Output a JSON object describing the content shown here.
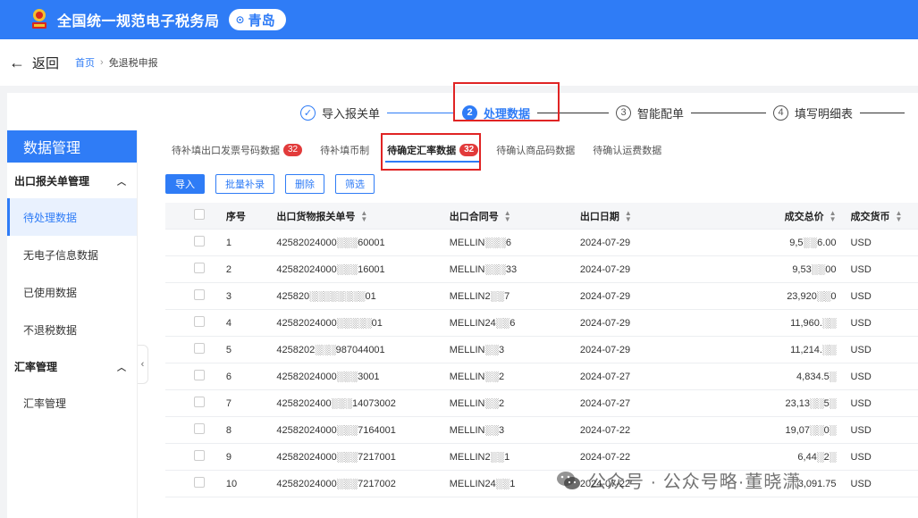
{
  "header": {
    "title": "全国统一规范电子税务局",
    "region": "青岛"
  },
  "nav": {
    "back_label": "返回",
    "breadcrumb": [
      "首页",
      "免退税申报"
    ]
  },
  "steps": [
    {
      "num": "✓",
      "label": "导入报关单",
      "state": "done"
    },
    {
      "num": "2",
      "label": "处理数据",
      "state": "active"
    },
    {
      "num": "3",
      "label": "智能配单",
      "state": "todo"
    },
    {
      "num": "4",
      "label": "填写明细表",
      "state": "todo"
    }
  ],
  "sidebar": {
    "title": "数据管理",
    "groups": [
      {
        "label": "出口报关单管理",
        "items": [
          "待处理数据",
          "无电子信息数据",
          "已使用数据",
          "不退税数据"
        ]
      },
      {
        "label": "汇率管理",
        "items": [
          "汇率管理"
        ]
      }
    ]
  },
  "tabs": [
    {
      "label": "待补填出口发票号码数据",
      "badge": "32"
    },
    {
      "label": "待补填币制",
      "badge": ""
    },
    {
      "label": "待确定汇率数据",
      "badge": "32"
    },
    {
      "label": "待确认商品码数据",
      "badge": ""
    },
    {
      "label": "待确认运费数据",
      "badge": ""
    }
  ],
  "toolbar": {
    "import": "导入",
    "batch": "批量补录",
    "delete": "删除",
    "filter": "筛选"
  },
  "table": {
    "columns": [
      "序号",
      "出口货物报关单号",
      "出口合同号",
      "出口日期",
      "成交总价",
      "成交货币"
    ],
    "rows": [
      [
        "1",
        "42582024000░░░60001",
        "MELLIN░░░6",
        "2024-07-29",
        "9,5░░6.00",
        "USD"
      ],
      [
        "2",
        "42582024000░░░16001",
        "MELLIN░░░33",
        "2024-07-29",
        "9,53░░00",
        "USD"
      ],
      [
        "3",
        "425820░░░░░░░░01",
        "MELLIN2░░7",
        "2024-07-29",
        "23,920░░0",
        "USD"
      ],
      [
        "4",
        "42582024000░░░░░01",
        "MELLIN24░░6",
        "2024-07-29",
        "11,960.░░",
        "USD"
      ],
      [
        "5",
        "4258202░░░987044001",
        "MELLIN░░3",
        "2024-07-29",
        "11,214.░░",
        "USD"
      ],
      [
        "6",
        "42582024000░░░3001",
        "MELLIN░░2",
        "2024-07-27",
        "4,834.5░",
        "USD"
      ],
      [
        "7",
        "4258202400░░░14073002",
        "MELLIN░░2",
        "2024-07-27",
        "23,13░░5░",
        "USD"
      ],
      [
        "8",
        "42582024000░░░7164001",
        "MELLIN░░3",
        "2024-07-22",
        "19,07░░0░",
        "USD"
      ],
      [
        "9",
        "42582024000░░░7217001",
        "MELLIN2░░1",
        "2024-07-22",
        "6,44░2░",
        "USD"
      ],
      [
        "10",
        "42582024000░░░7217002",
        "MELLIN24░░1",
        "2024-07-22",
        "3,091.75",
        "USD"
      ]
    ]
  },
  "watermark": {
    "text": "公众号 · 公众号略·董晓潇"
  },
  "colors": {
    "primary": "#2f7cf6",
    "highlight": "#e02424",
    "badge": "#e23b3b"
  }
}
